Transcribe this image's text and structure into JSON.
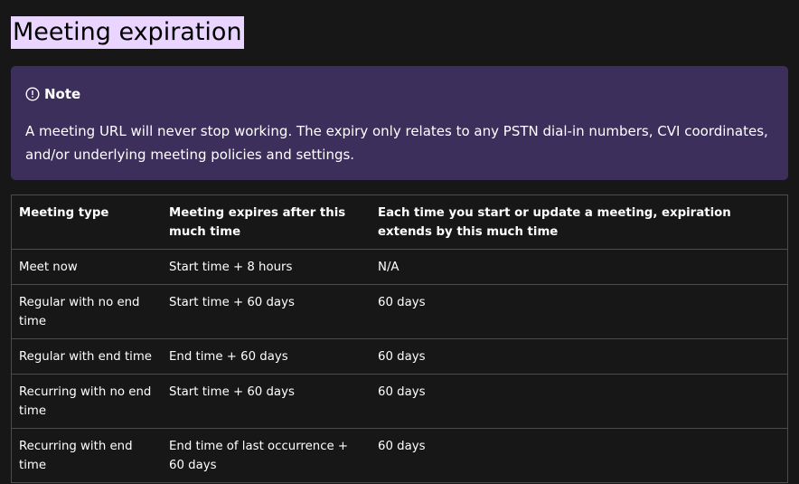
{
  "page": {
    "title": "Meeting expiration"
  },
  "note": {
    "icon": "info-circle-icon",
    "label": "Note",
    "text": "A meeting URL will never stop working. The expiry only relates to any PSTN dial-in numbers, CVI coordinates, and/or underlying meeting policies and settings."
  },
  "table": {
    "headers": [
      "Meeting type",
      "Meeting expires after this much time",
      "Each time you start or update a meeting, expiration extends by this much time"
    ],
    "rows": [
      [
        "Meet now",
        "Start time + 8 hours",
        "N/A"
      ],
      [
        "Regular with no end time",
        "Start time + 60 days",
        "60 days"
      ],
      [
        "Regular with end time",
        "End time + 60 days",
        "60 days"
      ],
      [
        "Recurring with no end time",
        "Start time + 60 days",
        "60 days"
      ],
      [
        "Recurring with end time",
        "End time of last occurrence + 60 days",
        "60 days"
      ]
    ]
  },
  "colors": {
    "background": "#171717",
    "note_background": "#3d2f5c",
    "title_highlight": "#e9d5ff",
    "border": "#4c4c4c"
  }
}
